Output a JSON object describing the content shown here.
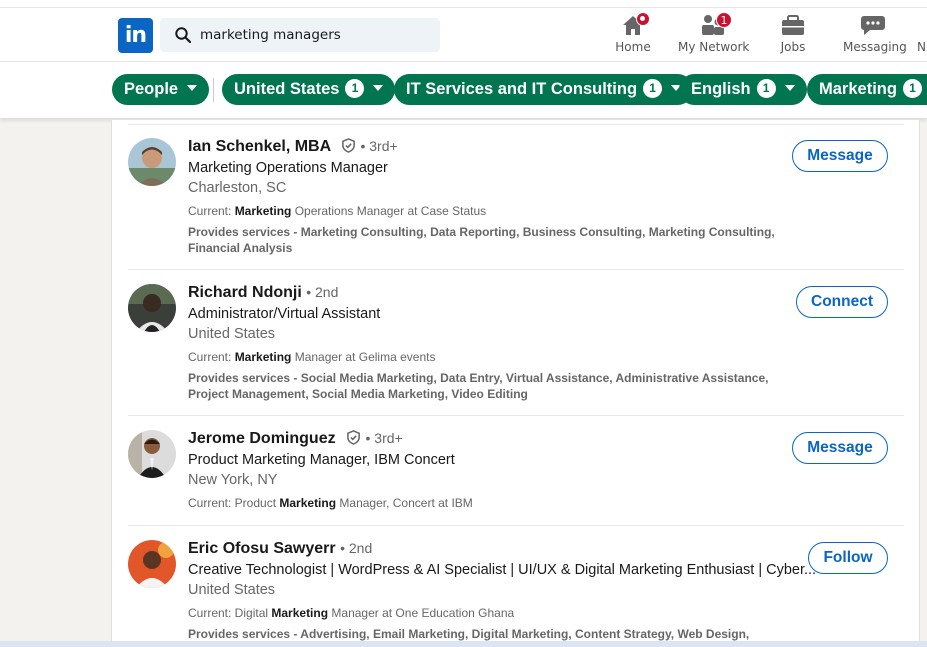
{
  "nav": {
    "logo_text": "in",
    "search_value": "marketing managers",
    "items": [
      {
        "label": "Home",
        "icon": "home-icon",
        "badge": ""
      },
      {
        "label": "My Network",
        "icon": "my-network-icon",
        "badge": "1"
      },
      {
        "label": "Jobs",
        "icon": "jobs-icon",
        "badge": ""
      },
      {
        "label": "Messaging",
        "icon": "messaging-icon",
        "badge": ""
      },
      {
        "label": "N",
        "icon": "notifications-icon",
        "badge": ""
      }
    ]
  },
  "filters": [
    {
      "label": "People",
      "count": ""
    },
    {
      "label": "United States",
      "count": "1"
    },
    {
      "label": "IT Services and IT Consulting",
      "count": "1"
    },
    {
      "label": "English",
      "count": "1"
    },
    {
      "label": "Marketing",
      "count": "1"
    }
  ],
  "results": [
    {
      "name": "Ian Schenkel, MBA",
      "degree": "• 3rd+",
      "headline": "Marketing Operations Manager",
      "location": "Charleston, SC",
      "current_prefix": "Current: ",
      "current_bold": "Marketing",
      "current_suffix": " Operations Manager at Case Status",
      "services": "Provides services - Marketing Consulting, Data Reporting, Business Consulting, Marketing Consulting, Financial Analysis",
      "action": "Message"
    },
    {
      "name": "Richard Ndonji",
      "degree": "• 2nd",
      "headline": "Administrator/Virtual Assistant",
      "location": "United States",
      "current_prefix": "Current: ",
      "current_bold": "Marketing",
      "current_suffix": " Manager at Gelima events",
      "services": "Provides services - Social Media Marketing, Data Entry, Virtual Assistance, Administrative Assistance, Project Management, Social Media Marketing, Video Editing",
      "action": "Connect"
    },
    {
      "name": "Jerome Dominguez",
      "degree": "• 3rd+",
      "headline": "Product Marketing Manager, IBM Concert",
      "location": "New York, NY",
      "current_prefix": "Current: Product ",
      "current_bold": "Marketing",
      "current_suffix": " Manager, Concert at IBM",
      "services": "",
      "action": "Message"
    },
    {
      "name": "Eric Ofosu Sawyerr",
      "degree": "• 2nd",
      "headline": "Creative Technologist | WordPress & AI Specialist | UI/UX & Digital Marketing Enthusiast | Cyber...",
      "location": "United States",
      "current_prefix": "Current: Digital ",
      "current_bold": "Marketing",
      "current_suffix": " Manager at One Education Ghana",
      "services": "Provides services - Advertising, Email Marketing, Digital Marketing, Content Strategy, Web Design,",
      "action": "Follow"
    }
  ],
  "colors": {
    "brand": "#0a66c2",
    "filter_green": "#01754f",
    "badge_red": "#cb112d"
  }
}
